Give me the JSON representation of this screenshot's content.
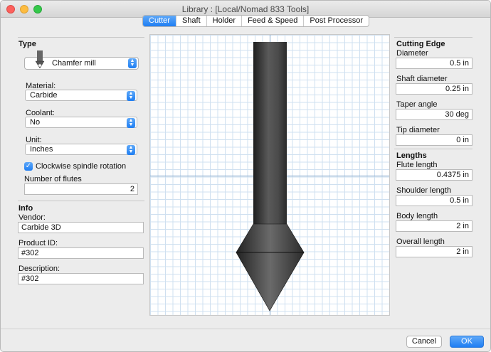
{
  "window": {
    "title": "Library :  [Local/Nomad 833 Tools]"
  },
  "tabs": [
    {
      "label": "Cutter",
      "active": true
    },
    {
      "label": "Shaft",
      "active": false
    },
    {
      "label": "Holder",
      "active": false
    },
    {
      "label": "Feed & Speed",
      "active": false
    },
    {
      "label": "Post Processor",
      "active": false
    }
  ],
  "type_section": {
    "title": "Type",
    "tool_type": "Chamfer mill",
    "material_label": "Material:",
    "material": "Carbide",
    "coolant_label": "Coolant:",
    "coolant": "No",
    "unit_label": "Unit:",
    "unit": "Inches",
    "clockwise_label": "Clockwise spindle rotation",
    "clockwise_checked": true,
    "flutes_label": "Number of flutes",
    "flutes": "2"
  },
  "info_section": {
    "title": "Info",
    "vendor_label": "Vendor:",
    "vendor": "Carbide 3D",
    "product_id_label": "Product ID:",
    "product_id": "#302",
    "description_label": "Description:",
    "description": "#302"
  },
  "cutting_edge": {
    "title": "Cutting Edge",
    "diameter_label": "Diameter",
    "diameter": "0.5 in",
    "shaft_diameter_label": "Shaft diameter",
    "shaft_diameter": "0.25 in",
    "taper_angle_label": "Taper angle",
    "taper_angle": "30 deg",
    "tip_diameter_label": "Tip diameter",
    "tip_diameter": "0 in"
  },
  "lengths": {
    "title": "Lengths",
    "flute_length_label": "Flute length",
    "flute_length": "0.4375 in",
    "shoulder_length_label": "Shoulder length",
    "shoulder_length": "0.5 in",
    "body_length_label": "Body length",
    "body_length": "2 in",
    "overall_length_label": "Overall length",
    "overall_length": "2 in"
  },
  "buttons": {
    "cancel": "Cancel",
    "ok": "OK"
  },
  "colors": {
    "accent": "#1f7ef3",
    "grid": "#cfe0f0",
    "axis": "#7fa3c8"
  },
  "icons": {
    "select_stepper": "up-down-chevron-icon",
    "tool_preview": "chamfer-mill-icon"
  }
}
